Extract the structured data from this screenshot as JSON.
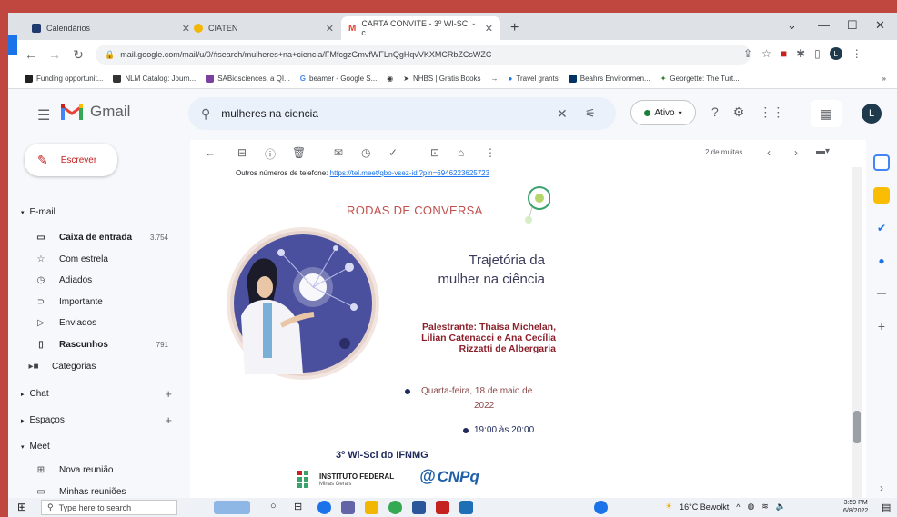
{
  "browser": {
    "tabs": [
      {
        "label": "Calendários",
        "color": "#1f3a6d"
      },
      {
        "label": "CIATEN",
        "color": "#f2b705"
      },
      {
        "label": "CARTA CONVITE - 3º WI-SCI - c...",
        "color": "#ea4335"
      }
    ],
    "url": "mail.google.com/mail/u/0/#search/mulheres+na+ciencia/FMfcgzGmvfWFLnQgHqvVKXMCRbZCsWZC",
    "bookmarks": [
      {
        "label": "Funding opportunit...",
        "color": "#222222"
      },
      {
        "label": "NLM Catalog: Journ...",
        "color": "#333333"
      },
      {
        "label": "SABiosciences, a QI...",
        "color": "#7b3fa0"
      },
      {
        "label": "beamer - Google S...",
        "color": "#4285f4"
      },
      {
        "label": "",
        "color": "#555555"
      },
      {
        "label": "NHBS | Gratis Books",
        "color": "#555555"
      },
      {
        "label": "",
        "color": "#777777"
      },
      {
        "label": "Travel grants",
        "color": "#1a73e8"
      },
      {
        "label": "Beahrs Environmen...",
        "color": "#003262"
      },
      {
        "label": "Georgette: The Turt...",
        "color": "#2e7d32"
      }
    ],
    "bookmarks_more": "»"
  },
  "gmail": {
    "logo": "Gmail",
    "search_value": "mulheres na ciencia",
    "status": "Ativo",
    "avatar_letter": "L",
    "compose": "Escrever",
    "sections": {
      "email": "E-mail",
      "chat": "Chat",
      "spaces": "Espaços",
      "meet": "Meet"
    },
    "folders": [
      {
        "label": "Caixa de entrada",
        "count": "3.754",
        "bold": true,
        "icon": "inbox-icon"
      },
      {
        "label": "Com estrela",
        "count": "",
        "bold": false,
        "icon": "star-icon"
      },
      {
        "label": "Adiados",
        "count": "",
        "bold": false,
        "icon": "clock-icon"
      },
      {
        "label": "Importante",
        "count": "",
        "bold": false,
        "icon": "important-icon"
      },
      {
        "label": "Enviados",
        "count": "",
        "bold": false,
        "icon": "send-icon"
      },
      {
        "label": "Rascunhos",
        "count": "791",
        "bold": true,
        "icon": "draft-icon"
      },
      {
        "label": "Categorias",
        "count": "",
        "bold": false,
        "icon": "label-icon"
      }
    ],
    "meet_items": [
      "Nova reunião",
      "Minhas reuniões"
    ],
    "pager": "2 de muitas"
  },
  "email": {
    "phone_label": "Outros números de telefone:",
    "phone_link": "https://tel.meet/qbo-vsez-idi?pin=6946223625723",
    "flyer_title": "RODAS DE CONVERSA",
    "headline_1": "Trajetória da",
    "headline_2": "mulher na ciência",
    "speakers_1": "Palestrante: Thaísa Michelan,",
    "speakers_2": "Lilian Catenacci e Ana Cecília",
    "speakers_3": "Rizzatti de Albergaria",
    "date_1": "Quarta-feira, 18 de maio de",
    "date_2": "2022",
    "time": "19:00 às 20:00",
    "event": "3º Wi-Sci do IFNMG",
    "logo_if": "INSTITUTO FEDERAL",
    "logo_if_sub": "Minas Gerais",
    "logo_cnpq": "CNPq"
  },
  "taskbar": {
    "search_placeholder": "Type here to search",
    "weather": "16°C Bewolkt",
    "time": "3:59 PM",
    "date": "6/8/2022"
  }
}
